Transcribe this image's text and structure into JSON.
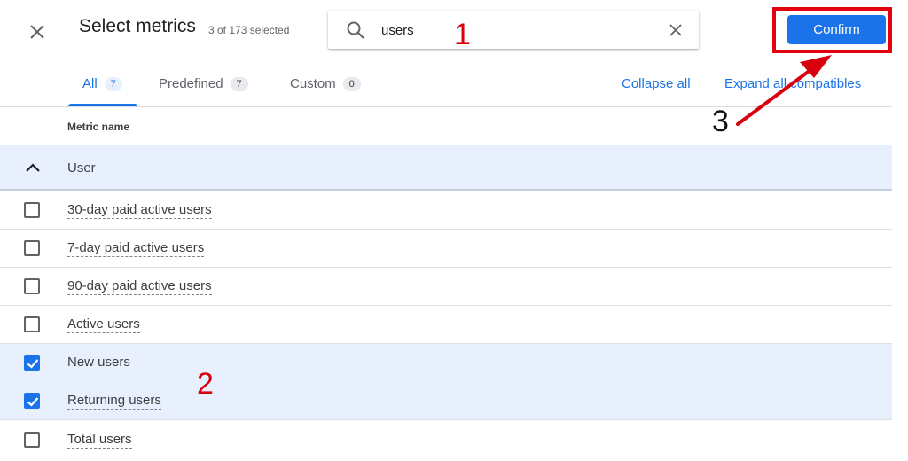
{
  "header": {
    "title": "Select metrics",
    "subtitle": "3 of 173 selected"
  },
  "search": {
    "value": "users",
    "placeholder": ""
  },
  "confirm_label": "Confirm",
  "tabs": [
    {
      "label": "All",
      "count": "7"
    },
    {
      "label": "Predefined",
      "count": "7"
    },
    {
      "label": "Custom",
      "count": "0"
    }
  ],
  "links": {
    "collapse_all": "Collapse all",
    "expand_all": "Expand all compatibles"
  },
  "table": {
    "column_header": "Metric name",
    "group": "User",
    "rows": [
      {
        "label": "30-day paid active users",
        "checked": false
      },
      {
        "label": "7-day paid active users",
        "checked": false
      },
      {
        "label": "90-day paid active users",
        "checked": false
      },
      {
        "label": "Active users",
        "checked": false
      },
      {
        "label": "New users",
        "checked": true
      },
      {
        "label": "Returning users",
        "checked": true
      },
      {
        "label": "Total users",
        "checked": false
      }
    ]
  },
  "annotations": {
    "step1": "1",
    "step2": "2",
    "step3": "3"
  },
  "colors": {
    "accent": "#1a73e8",
    "highlight": "#e3000f",
    "selected_row": "#e8f0fe"
  },
  "icons": [
    "close-icon",
    "search-icon",
    "clear-search-icon",
    "chevron-up-icon",
    "checkmark-icon"
  ]
}
